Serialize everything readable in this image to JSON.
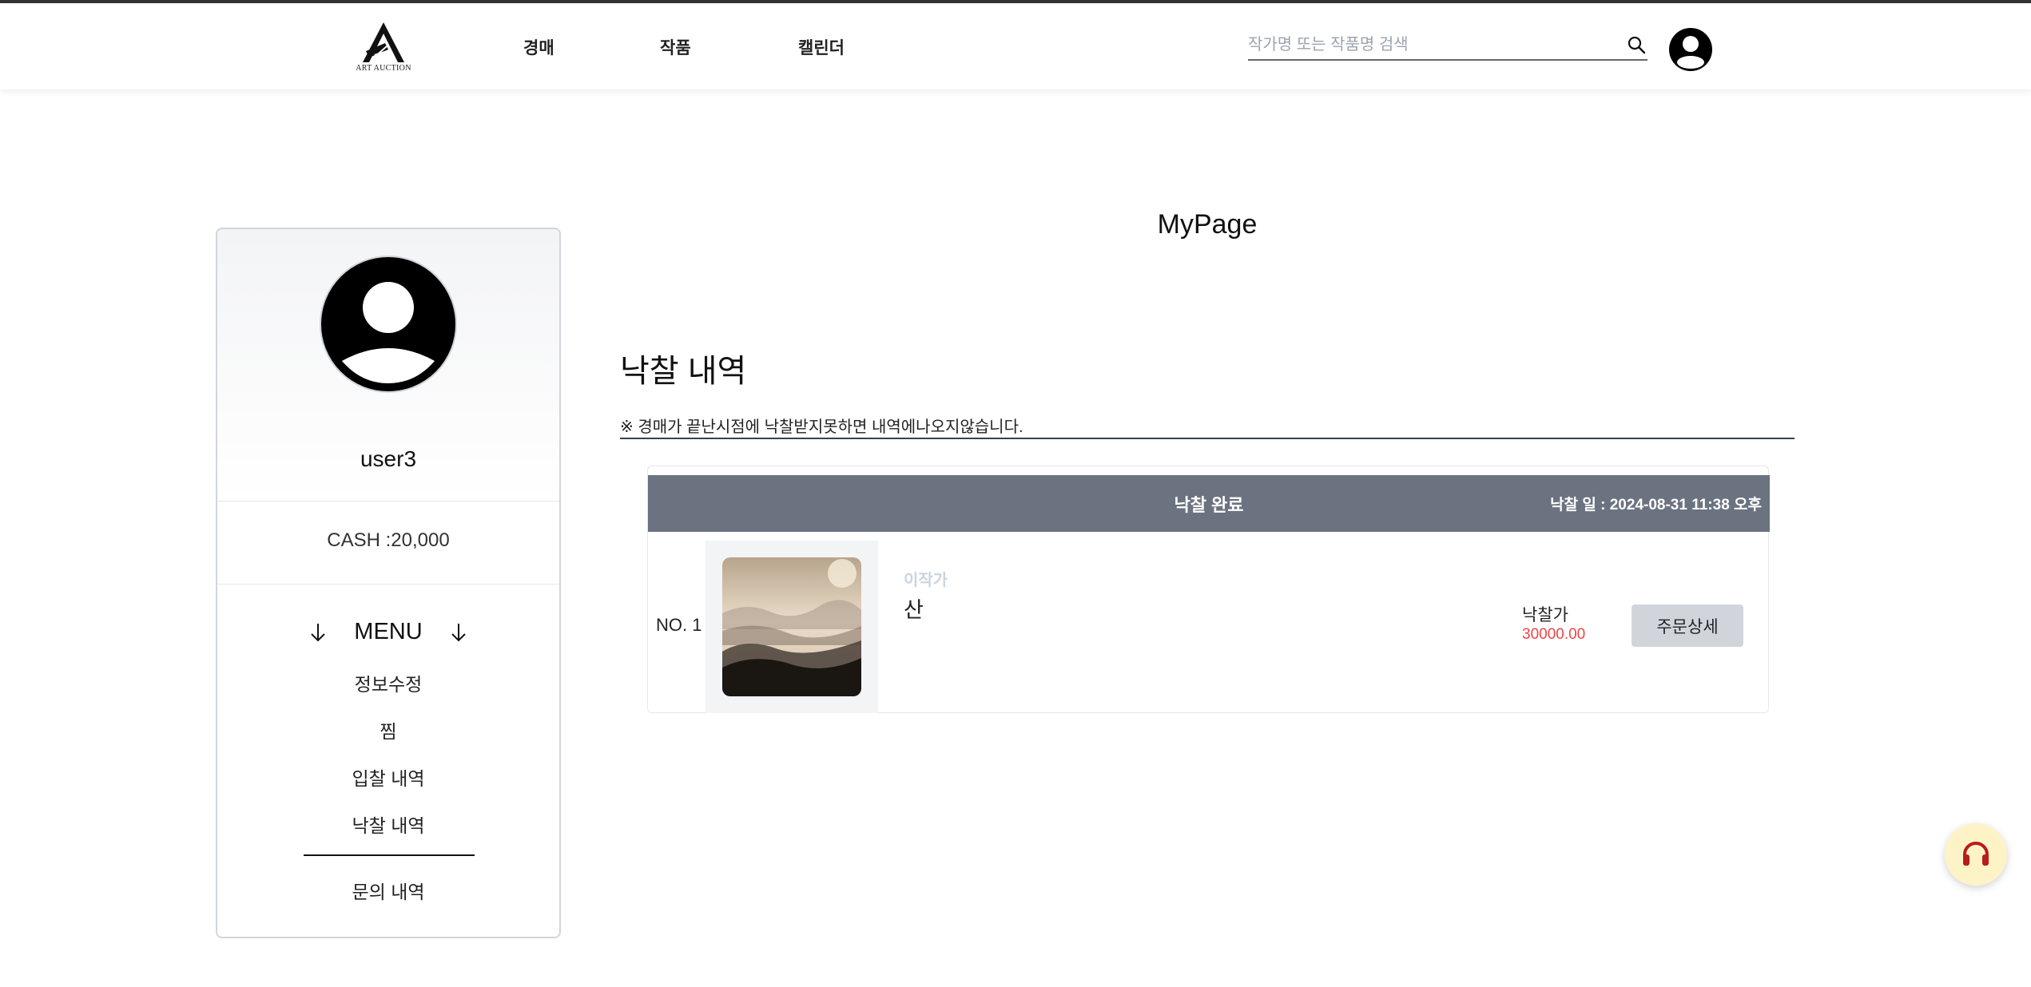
{
  "brand": {
    "logo_text": "ART AUCTION"
  },
  "nav": {
    "items": [
      {
        "label": "경매"
      },
      {
        "label": "작품"
      },
      {
        "label": "캘린더"
      }
    ]
  },
  "search": {
    "placeholder": "작가명 또는 작품명 검색",
    "value": ""
  },
  "sidebar": {
    "username": "user3",
    "cash": "CASH :20,000",
    "menu_title": "MENU",
    "menu_items": [
      {
        "label": "정보수정"
      },
      {
        "label": "찜"
      },
      {
        "label": "입찰 내역"
      },
      {
        "label": "낙찰 내역",
        "active": true
      },
      {
        "label": "문의 내역"
      }
    ]
  },
  "main": {
    "page_title": "MyPage",
    "section_title": "낙찰 내역",
    "notice": "※ 경매가 끝난시점에 낙찰받지못하면 내역에나오지않습니다.",
    "orders": [
      {
        "status": "낙찰 완료",
        "date_label": "낙찰 일 : 2024-08-31 11:38 오후",
        "no": "NO. 1",
        "artist": "이작가",
        "title": "산",
        "price_label": "낙찰가",
        "price": "30000.00",
        "detail_button": "주문상세"
      }
    ]
  },
  "colors": {
    "card_header": "#6b7280",
    "price": "#ef4444",
    "support_button": "#fef3c7",
    "support_icon": "#b91c1c"
  },
  "icons": [
    "search-icon",
    "user-avatar-icon",
    "arrow-down-icon",
    "headset-icon"
  ]
}
